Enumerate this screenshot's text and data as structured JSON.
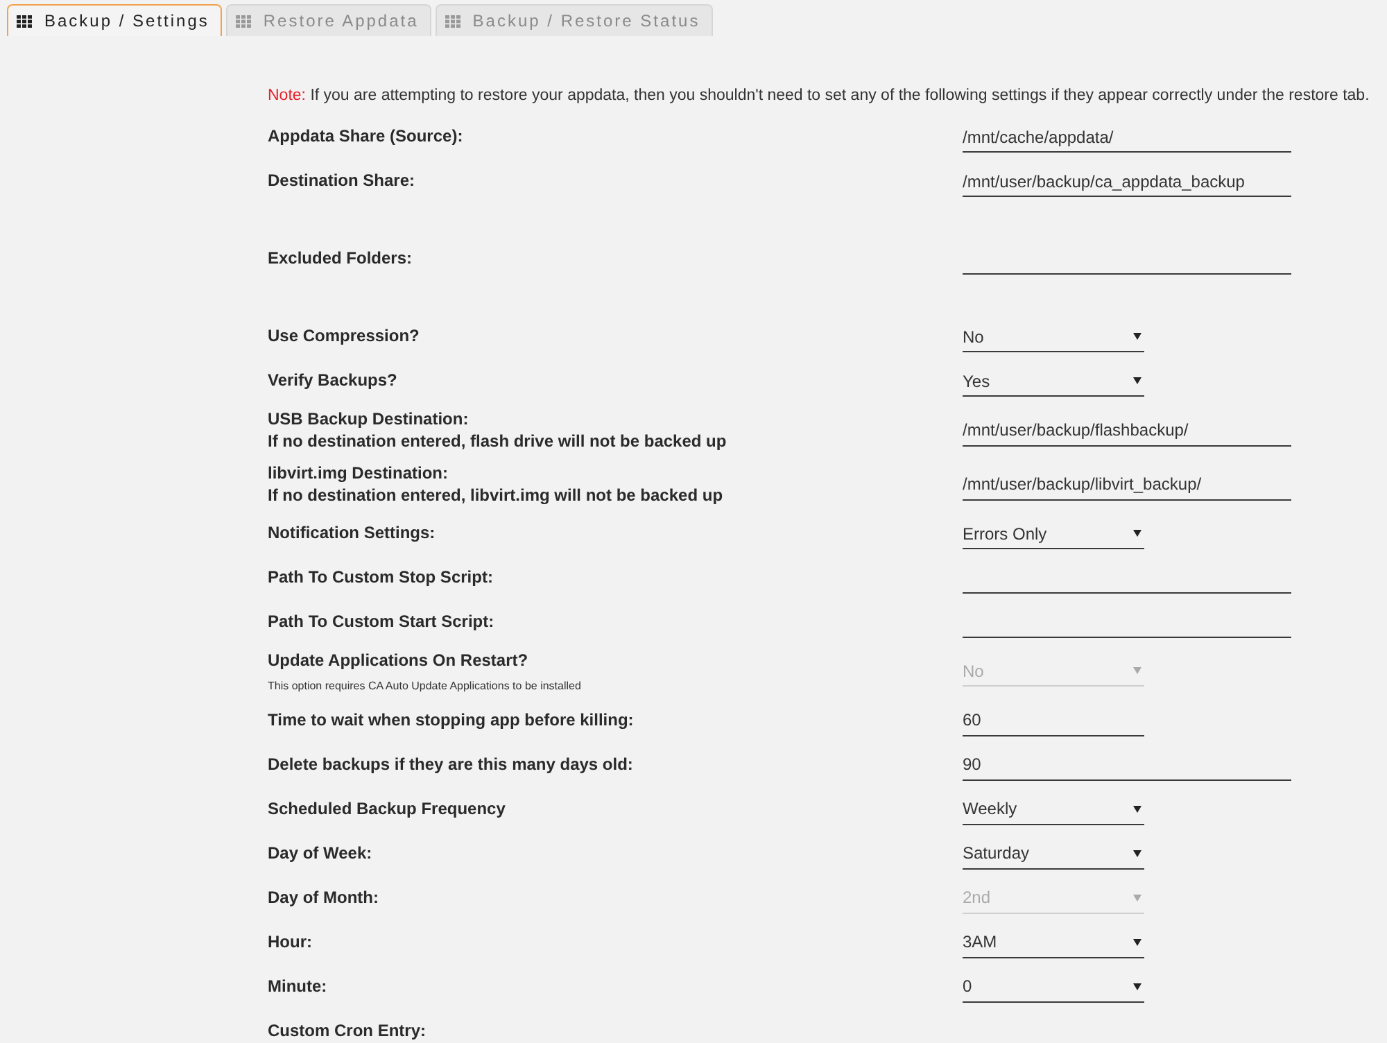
{
  "tabs": [
    {
      "label": "Backup / Settings",
      "selected": true
    },
    {
      "label": "Restore Appdata",
      "selected": false
    },
    {
      "label": "Backup / Restore Status",
      "selected": false
    }
  ],
  "note": {
    "prefix": "Note:",
    "text": "If you are attempting to restore your appdata, then you shouldn't need to set any of the following settings if they appear correctly under the restore tab."
  },
  "rows": [
    {
      "label": "Appdata Share (Source):",
      "kind": "input",
      "value": "/mnt/cache/appdata/",
      "disabled": false
    },
    {
      "label": "Destination Share:",
      "kind": "input",
      "value": "/mnt/user/backup/ca_appdata_backup",
      "disabled": false
    },
    {
      "label": "Excluded Folders:",
      "kind": "area",
      "disabled": false
    },
    {
      "label": "Use Compression?",
      "kind": "select",
      "value": "No",
      "disabled": false
    },
    {
      "label": "Verify Backups?",
      "kind": "select",
      "value": "Yes",
      "disabled": false
    },
    {
      "label": "USB Backup Destination:",
      "sublabel": "If no destination entered, flash drive will not be backed up",
      "kind": "input",
      "value": "/mnt/user/backup/flashbackup/",
      "disabled": false
    },
    {
      "label": "libvirt.img Destination:",
      "sublabel": "If no destination entered, libvirt.img will not be backed up",
      "kind": "input",
      "value": "/mnt/user/backup/libvirt_backup/",
      "disabled": false
    },
    {
      "label": "Notification Settings:",
      "kind": "select",
      "value": "Errors Only",
      "disabled": false
    },
    {
      "label": "Path To Custom Stop Script:",
      "kind": "input",
      "disabled": false
    },
    {
      "label": "Path To Custom Start Script:",
      "kind": "input",
      "disabled": false
    },
    {
      "label": "Update Applications On Restart?",
      "note": "This option requires CA Auto Update Applications to be installed",
      "kind": "select",
      "value": "No",
      "disabled": true
    },
    {
      "label": "Time to wait when stopping app before killing:",
      "kind": "short-input",
      "value": "60",
      "disabled": false
    },
    {
      "label": "Delete backups if they are this many days old:",
      "kind": "input",
      "value": "90",
      "disabled": false
    },
    {
      "label": "Scheduled Backup Frequency",
      "kind": "select",
      "value": "Weekly",
      "disabled": false
    },
    {
      "label": "Day of Week:",
      "kind": "select",
      "value": "Saturday",
      "disabled": false
    },
    {
      "label": "Day of Month:",
      "kind": "select",
      "value": "2nd",
      "disabled": true
    },
    {
      "label": "Hour:",
      "kind": "select",
      "value": "3AM",
      "disabled": false
    },
    {
      "label": "Minute:",
      "kind": "select",
      "value": "0",
      "disabled": false
    },
    {
      "label": "Custom Cron Entry:",
      "kind": "label"
    }
  ]
}
